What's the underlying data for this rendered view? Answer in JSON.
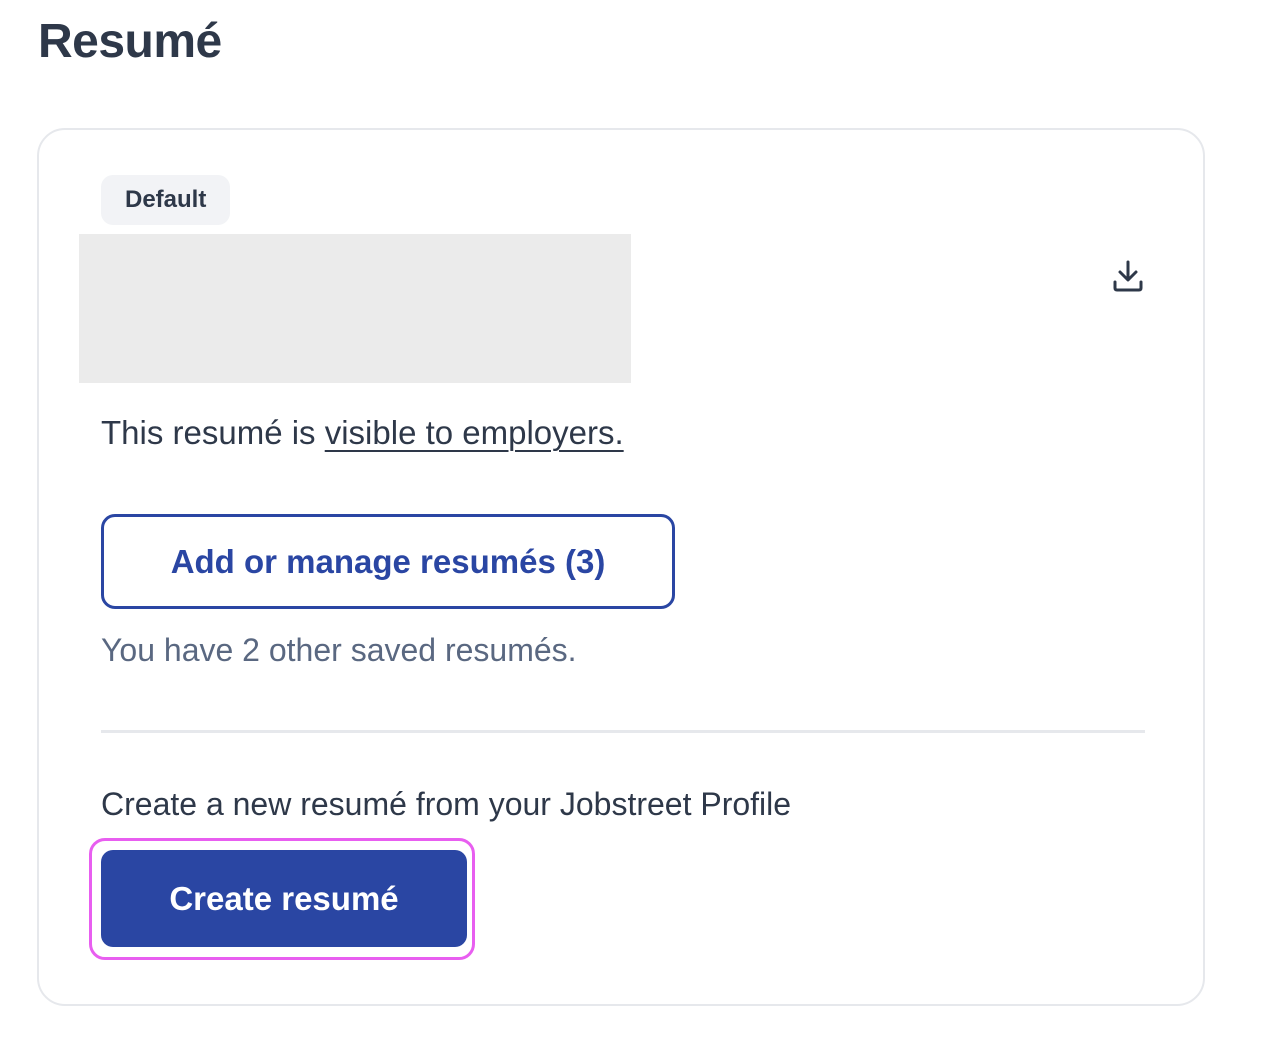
{
  "page": {
    "title": "Resumé"
  },
  "resume_card": {
    "badge": "Default",
    "download_icon": "download-icon",
    "visibility_prefix": "This resumé is ",
    "visibility_link": "visible to employers.",
    "manage_button_label": "Add or manage resumés (3)",
    "saved_text": "You have 2 other saved resumés.",
    "create_prompt": "Create a new resumé from your Jobstreet Profile",
    "create_button_label": "Create resumé"
  },
  "colors": {
    "brand": "#2a46a3",
    "focus_ring": "#e85ef0",
    "text_primary": "#2e3849",
    "text_secondary": "#5a6881"
  }
}
